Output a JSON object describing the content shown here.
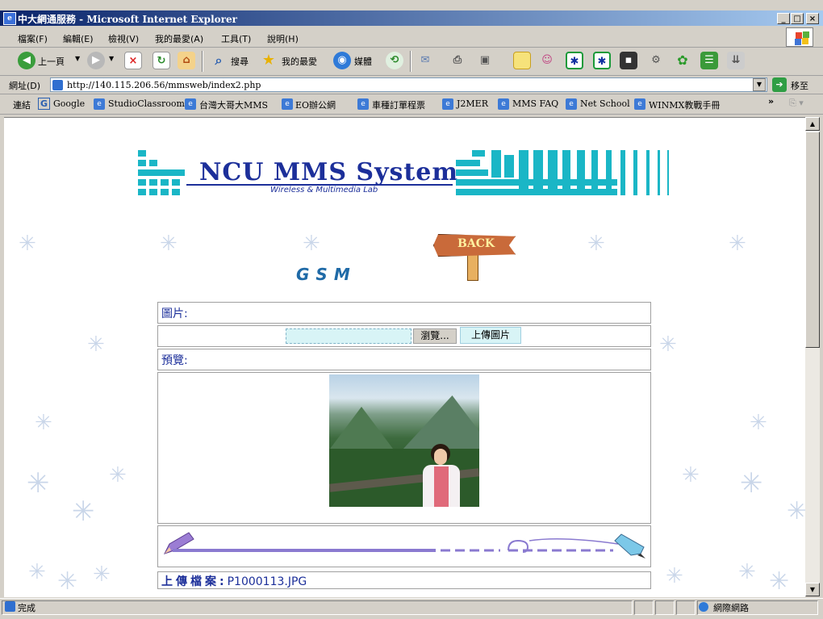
{
  "window": {
    "title": "中大網通服務 - Microsoft Internet Explorer",
    "minimize": "_",
    "maximize": "□",
    "close": "×"
  },
  "menu": [
    "檔案(F)",
    "編輯(E)",
    "檢視(V)",
    "我的最愛(A)",
    "工具(T)",
    "說明(H)"
  ],
  "toolbar": {
    "back_label": "上一頁",
    "search_label": "搜尋",
    "favorites_label": "我的最愛",
    "media_label": "媒體"
  },
  "address": {
    "label": "網址(D)",
    "url": "http://140.115.206.56/mmsweb/index2.php",
    "go_label": "移至"
  },
  "links": {
    "label": "連結",
    "items": [
      "Google",
      "StudioClassroom",
      "台灣大哥大MMS",
      "EO辦公網",
      "車種訂單程票",
      "J2MER",
      "MMS FAQ",
      "Net School",
      "WINMX教戰手冊"
    ]
  },
  "page": {
    "logo_title": "NCU MMS System",
    "logo_subtitle": "Wireless & Multimedia Lab",
    "back_sign": "BACK",
    "heading": "GSM",
    "picture_label": "圖片:",
    "browse_button": "瀏覽...",
    "upload_button": "上傳圖片",
    "preview_label": "預覽:",
    "upload_file_label": "上傳檔案:",
    "upload_file_name": "P1000113.JPG"
  },
  "status": {
    "text": "完成",
    "zone": "網際網路"
  },
  "colors": {
    "title_bar": "#0a246a",
    "accent_blue": "#1c2f9a",
    "logo_cyan": "#1ab6c6"
  }
}
